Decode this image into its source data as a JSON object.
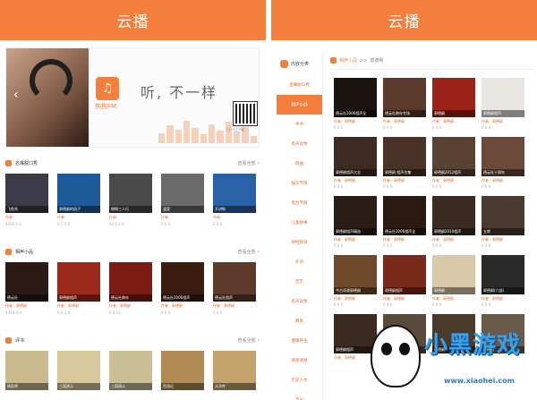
{
  "left": {
    "title": "云播",
    "banner": {
      "logo_text": "狗狗FM",
      "slogan": "听, 不一样",
      "qr_caption": "扫一扫下载"
    },
    "sections": [
      {
        "title": "名嘴脱口秀",
        "more": "查看全部",
        "cards": [
          {
            "caption": "飞鱼秀",
            "meta": "作者：",
            "stats": "4000 0 0",
            "bg": "#3b3b4a"
          },
          {
            "caption": "郭德纲的段子",
            "meta": "作者：",
            "stats": "0 5.5 0",
            "bg": "#1d5a9a"
          },
          {
            "caption": "锵锵三人行",
            "meta": "作者：",
            "stats": "10 6.4 0",
            "bg": "#4a4a4a"
          },
          {
            "caption": "逢案",
            "meta": "作者：",
            "stats": "0 0 0",
            "bg": "#6b6b6b"
          },
          {
            "caption": "开讲啦",
            "meta": "作者：",
            "stats": "2 0 0",
            "bg": "#2a62a8"
          }
        ]
      },
      {
        "title": "相声小品",
        "more": "查看全部",
        "cards": [
          {
            "caption": "德云社",
            "meta": "作者：郭德纲",
            "stats": "4349 0 0",
            "bg": "#2a1b16"
          },
          {
            "caption": "郭德纲相声",
            "meta": "作者：郭德纲",
            "stats": "0 6.2 0",
            "bg": "#9b2a1a"
          },
          {
            "caption": "德云社跨年",
            "meta": "作者：郭德纲",
            "stats": "0 0 11",
            "bg": "#7b1c14"
          },
          {
            "caption": "德云社2006相声",
            "meta": "作者：郭德纲",
            "stats": "0 0 0",
            "bg": "#3a1d0f"
          },
          {
            "caption": "德云社相声",
            "meta": "作者：郭德纲",
            "stats": "0 0 0",
            "bg": "#5e3a2a"
          }
        ]
      },
      {
        "title": "评书",
        "more": "查看全部",
        "cards": [
          {
            "caption": "杨家将",
            "meta": "",
            "stats": "",
            "bg": "#c9b98c"
          },
          {
            "caption": "三国演义",
            "meta": "",
            "stats": "",
            "bg": "#d7c79a"
          },
          {
            "caption": "三国演义",
            "meta": "",
            "stats": "",
            "bg": "#cbbf95"
          },
          {
            "caption": "西游记",
            "meta": "",
            "stats": "",
            "bg": "#b28a55"
          },
          {
            "caption": "水浒传",
            "meta": "",
            "stats": "",
            "bg": "#c4a26b"
          }
        ]
      }
    ]
  },
  "right": {
    "title": "云播",
    "sidebar": {
      "title": "内容分类",
      "categories": [
        "名嘴脱口秀",
        "相声小品",
        "评书",
        "有声读物",
        "戏曲",
        "娱乐节目",
        "电台节目",
        "儿童故事",
        "财经频道",
        "外语",
        "百艺",
        "有声读物",
        "教育",
        "健康养生",
        "情感调频",
        "历史人文",
        "音乐"
      ],
      "active_index": 1
    },
    "breadcrumb": {
      "current": "相声小品",
      "sep": ">>",
      "sub": "郭德纲"
    },
    "grid": [
      {
        "caption": "德云社2006相声全",
        "author": "作者：郭德纲",
        "stats": "0 0 0",
        "bg": "#1c1410"
      },
      {
        "caption": "德云社跨年专场",
        "author": "作者：郭德纲",
        "stats": "0 0 0",
        "bg": "#5a3a2a"
      },
      {
        "caption": "郭德纲",
        "author": "作者：郭德纲",
        "stats": "0 0 0",
        "bg": "#9b2216"
      },
      {
        "caption": "郭德纲相声",
        "author": "作者：郭德纲",
        "stats": "0 0 0",
        "bg": "#e9e6e2"
      },
      {
        "caption": "郭德纲相声大全",
        "author": "作者：郭德纲",
        "stats": "0 0 0",
        "bg": "#3e2a22"
      },
      {
        "caption": "郭德纲 相声合集",
        "author": "作者：郭德纲",
        "stats": "0 0 0",
        "bg": "#4a3226"
      },
      {
        "caption": "郭德纲2012相声",
        "author": "作者：郭德纲",
        "stats": "0 0 0",
        "bg": "#5a4232"
      },
      {
        "caption": "德云社十周年",
        "author": "作者：郭德纲",
        "stats": "0 0 0",
        "bg": "#6b4a3a"
      },
      {
        "caption": "郭德纲相声精选",
        "author": "作者：郭德纲",
        "stats": "0 0 0",
        "bg": "#2a1c16"
      },
      {
        "caption": "德云社2006相声全",
        "author": "作者：郭德纲",
        "stats": "0 0 0",
        "bg": "#2a1a12"
      },
      {
        "caption": "郭德纲2010相声",
        "author": "作者：郭德纲",
        "stats": "0 0 0",
        "bg": "#3a2a20"
      },
      {
        "caption": "五郎",
        "author": "作者：郭德纲",
        "stats": "0 0 0",
        "bg": "#4a3a30"
      },
      {
        "caption": "今古奇观郭德纲",
        "author": "作者：郭德纲",
        "stats": "0 0 0",
        "bg": "#6e4a2a"
      },
      {
        "caption": "郭德纲相声",
        "author": "作者：郭德纲",
        "stats": "0 0 0",
        "bg": "#7a2a1a"
      },
      {
        "caption": "郭德纲",
        "author": "作者：郭德纲",
        "stats": "0 0 0",
        "bg": "#d9c9a8"
      },
      {
        "caption": "郭德纲(六部)",
        "author": "作者：郭德纲",
        "stats": "0 0 0",
        "bg": "#2a2a2a"
      },
      {
        "caption": "郭德纲相声",
        "author": "作者：郭德纲",
        "stats": "",
        "bg": "#3a2a20"
      },
      {
        "caption": "郭德纲",
        "author": "作者：郭德纲",
        "stats": "",
        "bg": "#5a4a3a"
      },
      {
        "caption": "郭德纲",
        "author": "",
        "stats": "",
        "bg": "#4a3a2a"
      },
      {
        "caption": "郭德纲",
        "author": "",
        "stats": "",
        "bg": "#6a5a4a"
      }
    ]
  },
  "watermark": {
    "title": "小黑游戏",
    "url": "www.xiaohei.com"
  },
  "colors": {
    "accent": "#f47f3c"
  }
}
